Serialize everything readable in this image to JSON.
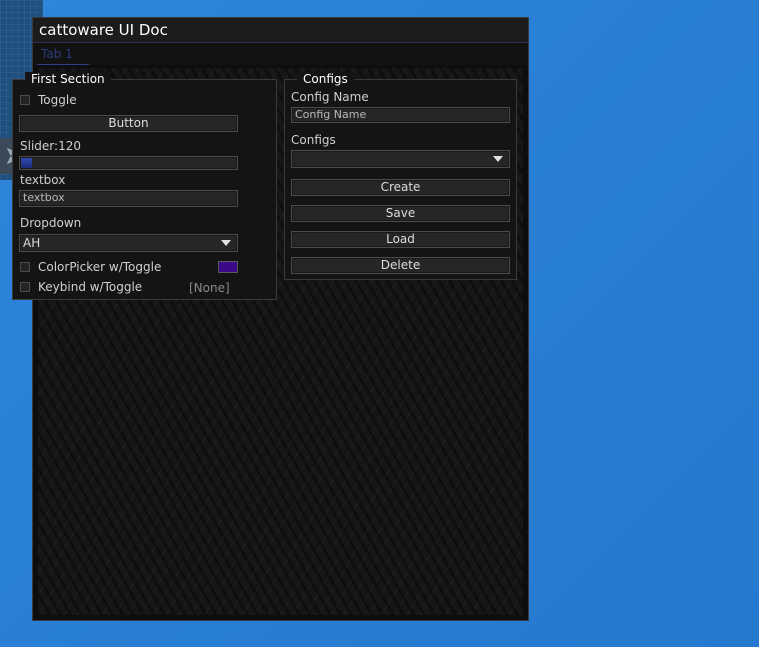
{
  "window": {
    "title": "cattoware UI Doc"
  },
  "tabs": [
    {
      "label": "Tab 1"
    }
  ],
  "first_section": {
    "title": "First Section",
    "toggle_label": "Toggle",
    "button_label": "Button",
    "slider_label": "Slider:",
    "slider_value": "120",
    "slider_fraction": 0.05,
    "textbox_label": "textbox",
    "textbox_value": "textbox",
    "dropdown_label": "Dropdown",
    "dropdown_value": "AH",
    "colorpicker_label": "ColorPicker w/Toggle",
    "colorpicker_color": "#3a0a8a",
    "keybind_label": "Keybind w/Toggle",
    "keybind_value": "[None]"
  },
  "configs": {
    "title": "Configs",
    "config_name_label": "Config Name",
    "config_name_placeholder": "Config Name",
    "configs_label": "Configs",
    "configs_selected": "",
    "create_label": "Create",
    "save_label": "Save",
    "load_label": "Load",
    "delete_label": "Delete"
  },
  "colors": {
    "accent": "#2e3f8f",
    "desktop": "#2a7fd6",
    "window_bg": "#0d0d0d"
  }
}
